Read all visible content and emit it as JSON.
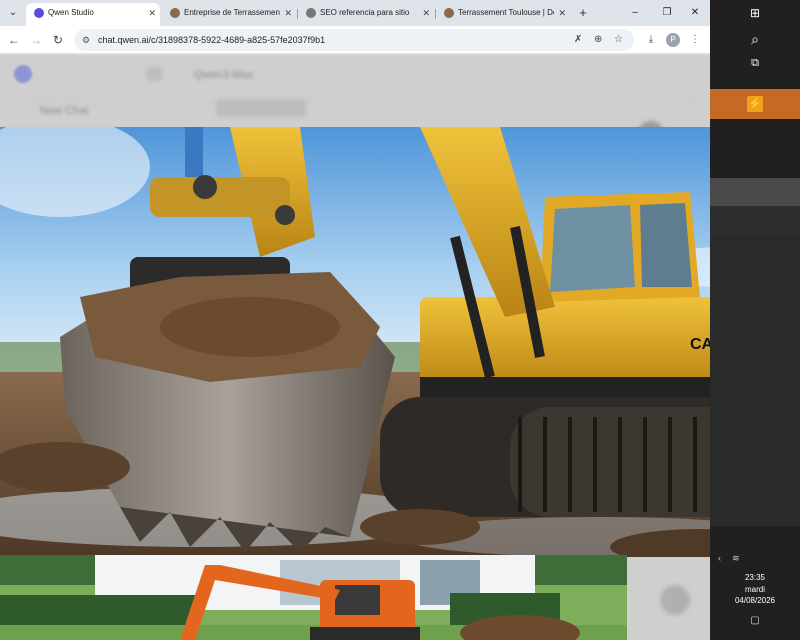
{
  "browser": {
    "tabs": [
      {
        "title": "Qwen Studio",
        "favicon_color": "#5b4cdb",
        "active": true
      },
      {
        "title": "Entreprise de Terrassement",
        "favicon_color": "#8a6a4a",
        "active": false
      },
      {
        "title": "SEO referencia para sitio",
        "favicon_color": "#777777",
        "active": false
      },
      {
        "title": "Terrassement Toulouse | De",
        "favicon_color": "#8a6a4a",
        "active": false
      }
    ],
    "new_tab_label": "+",
    "window_controls": {
      "minimize": "–",
      "restore": "❐",
      "close": "✕"
    },
    "address": "chat.qwen.ai/c/31898378-5922-4689-a825-57fe2037f9b1",
    "profile_initial": "P"
  },
  "page_behind": {
    "header_text": "Qwen3-Max",
    "search_text": "New Chat"
  },
  "viewer": {
    "main_image": "excavator-bucket-photo",
    "secondary_image": "orange-mini-excavator-photo"
  },
  "taskbar": {
    "time": "23:35",
    "day": "mardi",
    "date": "04/08/2026",
    "app_icon_letter": "⚡",
    "accent": "#c46a25"
  }
}
